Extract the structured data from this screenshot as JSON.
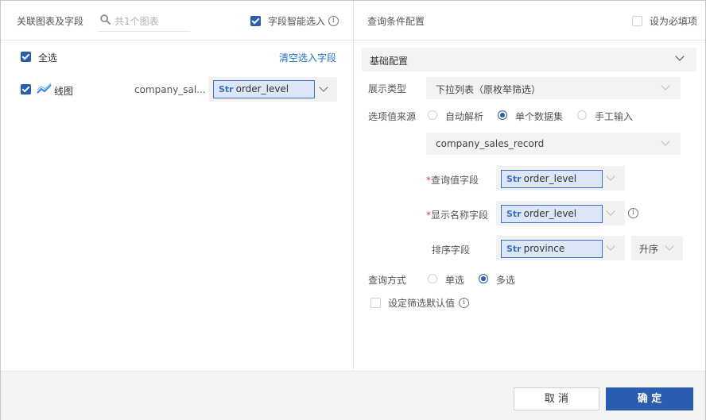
{
  "left": {
    "title": "关联图表及字段",
    "search_placeholder": "共1个图表",
    "smart_select_label": "字段智能选入",
    "select_all_label": "全选",
    "clear_link": "清空选入字段",
    "chart_row": {
      "name": "线图",
      "dataset": "company_sal...",
      "field_type": "Str",
      "field": "order_level"
    }
  },
  "right": {
    "title": "查询条件配置",
    "required_label": "设为必填项",
    "section_title": "基础配置",
    "display_type_label": "展示类型",
    "display_type_value": "下拉列表（原枚举筛选）",
    "source_label": "选项值来源",
    "source_options": [
      "自动解析",
      "单个数据集",
      "手工输入"
    ],
    "source_selected": "单个数据集",
    "dataset_value": "company_sales_record",
    "query_field_label": "查询值字段",
    "query_field": {
      "type": "Str",
      "name": "order_level"
    },
    "display_field_label": "显示名称字段",
    "display_field": {
      "type": "Str",
      "name": "order_level"
    },
    "sort_field_label": "排序字段",
    "sort_field": {
      "type": "Str",
      "name": "province"
    },
    "sort_order": "升序",
    "query_mode_label": "查询方式",
    "query_mode_options": [
      "单选",
      "多选"
    ],
    "query_mode_selected": "多选",
    "default_label": "设定筛选默认值",
    "required_mark": "*"
  },
  "footer": {
    "cancel_label": "取 消",
    "ok_label": "确 定"
  },
  "colors": {
    "accent": "#2a5db0",
    "link": "#1f6fd1",
    "chip_bg": "#dbe6f6",
    "required": "#e03b3b"
  },
  "icons": {
    "search": "search-icon",
    "chart": "line-chart-icon",
    "info": "info-icon",
    "chevron": "chevron-down-icon"
  }
}
